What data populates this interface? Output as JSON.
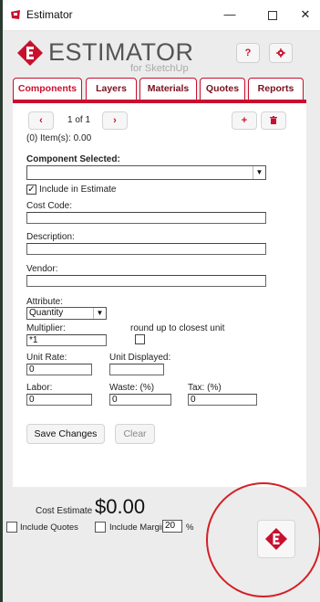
{
  "window": {
    "title": "Estimator",
    "minimize_glyph": "—",
    "close_glyph": "✕"
  },
  "header": {
    "logo_title": "ESTIMATOR",
    "logo_subtitle": "for SketchUp",
    "help_label": "?",
    "brand_color": "#c8102e"
  },
  "tabs": [
    {
      "label": "Components",
      "active": true
    },
    {
      "label": "Layers"
    },
    {
      "label": "Materials"
    },
    {
      "label": "Quotes"
    },
    {
      "label": "Reports"
    }
  ],
  "pager": {
    "prev": "‹",
    "next": "›",
    "position": "1 of 1",
    "items_text": "(0) Item(s): 0.00",
    "add": "+"
  },
  "form": {
    "component_selected_label": "Component Selected:",
    "component_selected_value": "",
    "include_in_estimate_label": "Include in Estimate",
    "include_in_estimate_checked": true,
    "cost_code_label": "Cost Code:",
    "cost_code_value": "",
    "description_label": "Description:",
    "description_value": "",
    "vendor_label": "Vendor:",
    "vendor_value": "",
    "attribute_label": "Attribute:",
    "attribute_value": "Quantity",
    "multiplier_label": "Multiplier:",
    "multiplier_value": "*1",
    "round_up_label": "round up to closest unit",
    "unit_rate_label": "Unit Rate:",
    "unit_rate_value": "0",
    "unit_displayed_label": "Unit Displayed:",
    "unit_displayed_value": "",
    "labor_label": "Labor:",
    "labor_value": "0",
    "waste_label": "Waste: (%)",
    "waste_value": "0",
    "tax_label": "Tax: (%)",
    "tax_value": "0",
    "save_label": "Save Changes",
    "clear_label": "Clear"
  },
  "footer": {
    "cost_estimate_label": "Cost Estimate",
    "cost_estimate_value": "$0.00",
    "include_quotes_label": "Include Quotes",
    "include_margin_label": "Include Margin",
    "margin_value": "20",
    "percent_sign": "%"
  }
}
